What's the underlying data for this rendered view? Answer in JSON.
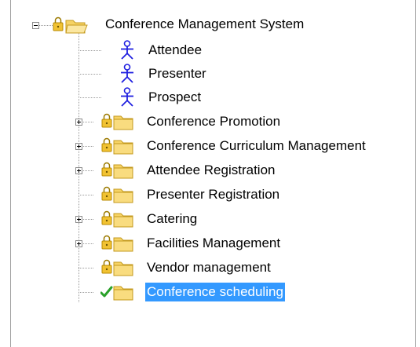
{
  "tree": {
    "root": {
      "label": "Conference Management System",
      "icon": "locked-open-folder-icon",
      "expanded": true
    },
    "actors": [
      {
        "label": "Attendee",
        "icon": "actor-icon"
      },
      {
        "label": "Presenter",
        "icon": "actor-icon"
      },
      {
        "label": "Prospect",
        "icon": "actor-icon"
      }
    ],
    "packages": [
      {
        "label": "Conference Promotion",
        "icon": "locked-folder-icon",
        "expandable": true
      },
      {
        "label": "Conference Curriculum Management",
        "icon": "locked-folder-icon",
        "expandable": true
      },
      {
        "label": "Attendee Registration",
        "icon": "locked-folder-icon",
        "expandable": true
      },
      {
        "label": "Presenter Registration",
        "icon": "locked-folder-icon",
        "expandable": false
      },
      {
        "label": "Catering",
        "icon": "locked-folder-icon",
        "expandable": true
      },
      {
        "label": "Facilities Management",
        "icon": "locked-folder-icon",
        "expandable": true
      },
      {
        "label": "Vendor management",
        "icon": "locked-folder-icon",
        "expandable": false
      },
      {
        "label": "Conference scheduling",
        "icon": "checked-out-folder-icon",
        "expandable": false,
        "selected": true
      }
    ]
  },
  "colors": {
    "selection": "#3399ff",
    "folder": "#f6d365",
    "lock": "#c9a227",
    "actor": "#1f1fe0",
    "check": "#2aa12a"
  }
}
